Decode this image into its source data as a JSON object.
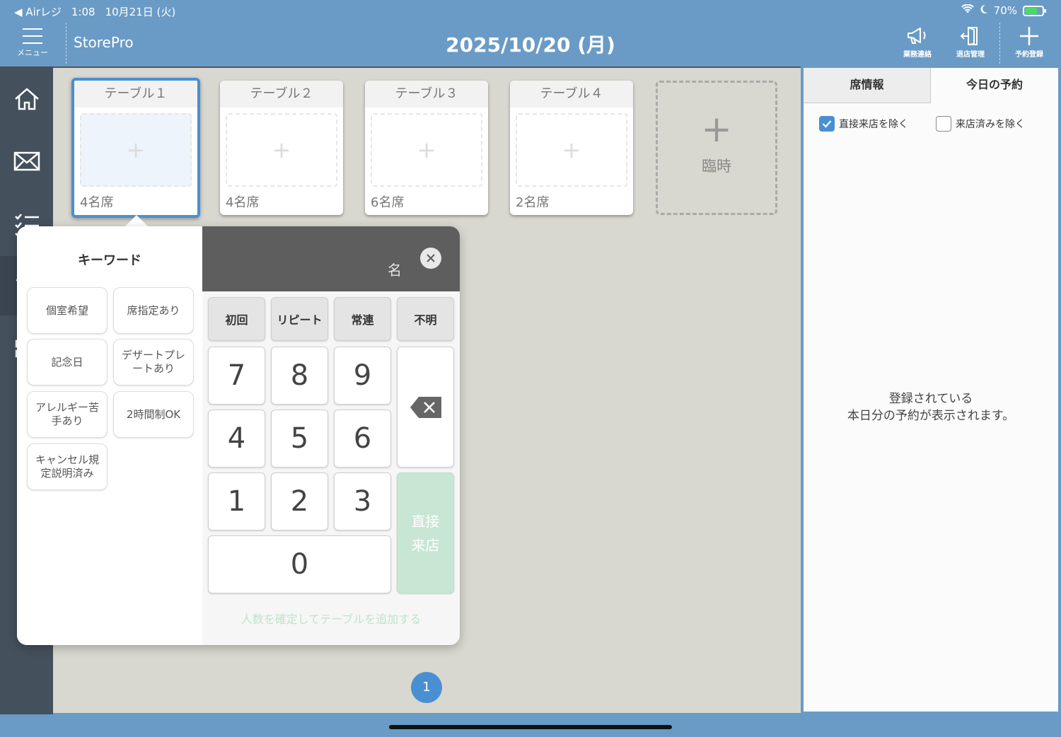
{
  "status": {
    "back_app": "◀ Airレジ",
    "time": "1:08",
    "date": "10月21日 (火)",
    "battery": "70%",
    "battery_level": 0.7
  },
  "header": {
    "menu_label": "メニュー",
    "store_name": "StorePro",
    "date": "2025/10/20 (月)",
    "actions": [
      {
        "label": "業務連絡"
      },
      {
        "label": "退店管理"
      },
      {
        "label": "予約登録"
      }
    ]
  },
  "tables": [
    {
      "name": "テーブル１",
      "capacity": "4名席",
      "selected": true
    },
    {
      "name": "テーブル２",
      "capacity": "4名席",
      "selected": false
    },
    {
      "name": "テーブル３",
      "capacity": "6名席",
      "selected": false
    },
    {
      "name": "テーブル４",
      "capacity": "2名席",
      "selected": false
    }
  ],
  "temp_table": {
    "plus": "+",
    "label": "臨時"
  },
  "seat_plus": "+",
  "page_indicator": "1",
  "right_panel": {
    "tabs": [
      "席情報",
      "今日の予約"
    ],
    "filters": [
      {
        "label": "直接来店を除く",
        "checked": true
      },
      {
        "label": "来店済みを除く",
        "checked": false
      }
    ],
    "empty_line1": "登録されている",
    "empty_line2": "本日分の予約が表示されます。"
  },
  "popover": {
    "keyword_title": "キーワード",
    "keywords": [
      "個室希望",
      "席指定あり",
      "記念日",
      "デザートプレートあり",
      "アレルギー苦手あり",
      "2時間制OK",
      "キャンセル規定説明済み"
    ],
    "unit": "名",
    "categories": [
      "初回",
      "リピート",
      "常連",
      "不明"
    ],
    "digits": [
      "7",
      "8",
      "9",
      "4",
      "5",
      "6",
      "1",
      "2",
      "3",
      "0"
    ],
    "enter_line1": "直接",
    "enter_line2": "来店",
    "footer": "人数を確定してテーブルを追加する"
  },
  "colors": {
    "accent": "#4a8fd1",
    "header": "#6a9bc6",
    "sidebar": "#44505c",
    "enter": "#c8e6d4"
  }
}
